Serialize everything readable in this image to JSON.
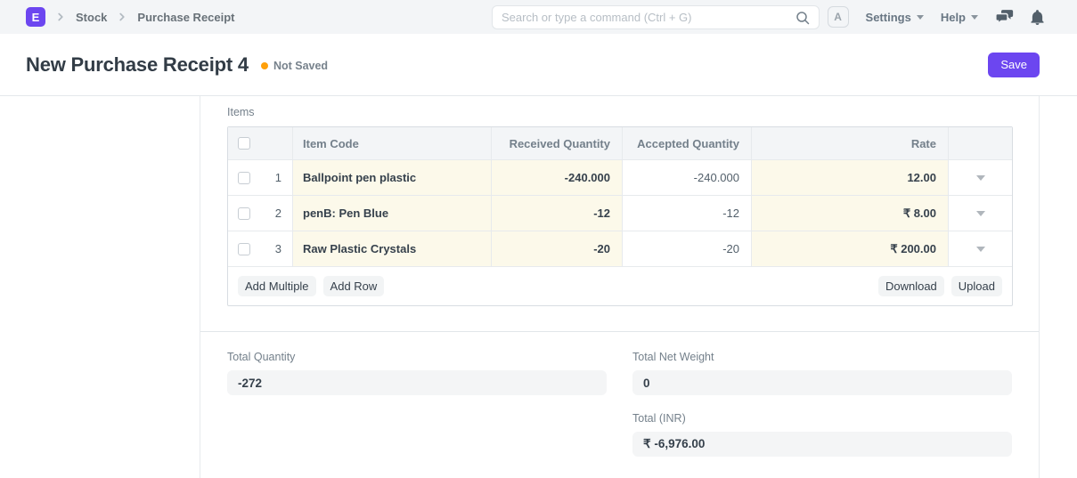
{
  "navbar": {
    "logo_letter": "E",
    "breadcrumbs": [
      "Stock",
      "Purchase Receipt"
    ],
    "search_placeholder": "Search or type a command (Ctrl + G)",
    "avatar_letter": "A",
    "settings_label": "Settings",
    "help_label": "Help"
  },
  "page_head": {
    "title": "New Purchase Receipt 4",
    "status_indicator": "Not Saved",
    "save_button": "Save"
  },
  "items_section": {
    "section_label": "Items",
    "grid": {
      "headers": {
        "item_code": "Item Code",
        "received_qty": "Received Quantity",
        "accepted_qty": "Accepted Quantity",
        "rate": "Rate"
      },
      "rows": [
        {
          "idx": "1",
          "item_code": "Ballpoint pen plastic",
          "received_qty": "-240.000",
          "accepted_qty": "-240.000",
          "rate": "12.00"
        },
        {
          "idx": "2",
          "item_code": "penB: Pen Blue",
          "received_qty": "-12",
          "accepted_qty": "-12",
          "rate": "₹ 8.00"
        },
        {
          "idx": "3",
          "item_code": "Raw Plastic Crystals",
          "received_qty": "-20",
          "accepted_qty": "-20",
          "rate": "₹ 200.00"
        }
      ],
      "footer": {
        "add_multiple": "Add Multiple",
        "add_row": "Add Row",
        "download": "Download",
        "upload": "Upload"
      }
    }
  },
  "totals_section": {
    "total_quantity": {
      "label": "Total Quantity",
      "value": "-272"
    },
    "total_net_weight": {
      "label": "Total Net Weight",
      "value": "0"
    },
    "total_inr": {
      "label": "Total (INR)",
      "value": "₹ -6,976.00"
    }
  },
  "colors": {
    "accent": "#6c46f0",
    "status_dot": "#ffa00a",
    "highlight_cell": "#fcf9ea",
    "navbar_bg": "#f3f5f7"
  }
}
